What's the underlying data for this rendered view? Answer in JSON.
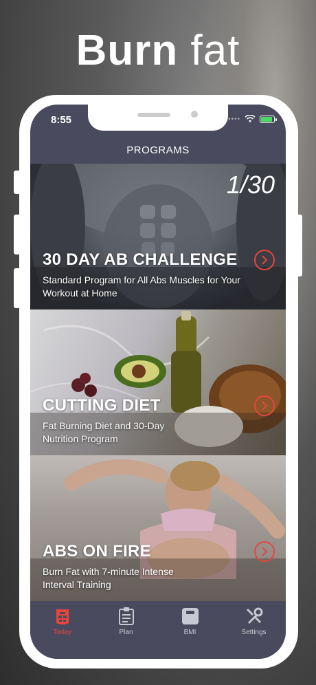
{
  "headline": {
    "bold": "Burn",
    "regular": "fat"
  },
  "status": {
    "time": "8:55",
    "battery_level": 0.8
  },
  "nav": {
    "title": "PROGRAMS"
  },
  "programs": [
    {
      "title": "30 DAY AB CHALLENGE",
      "subtitle": "Standard Program for All Abs Muscles for Your Workout at Home",
      "progress": "1/30"
    },
    {
      "title": "CUTTING DIET",
      "subtitle": "Fat Burning Diet and 30-Day Nutrition Program"
    },
    {
      "title": "ABS ON FIRE",
      "subtitle": "Burn Fat with 7-minute Intense Interval Training"
    }
  ],
  "tabs": [
    {
      "label": "Today",
      "icon": "today-icon",
      "active": true
    },
    {
      "label": "Plan",
      "icon": "clipboard-icon",
      "active": false
    },
    {
      "label": "BMI",
      "icon": "scale-icon",
      "active": false
    },
    {
      "label": "Settings",
      "icon": "tools-icon",
      "active": false
    }
  ],
  "colors": {
    "accent": "#e8453c",
    "tabbar": "#4a4a5e",
    "tab_inactive": "#c9c9d3"
  }
}
